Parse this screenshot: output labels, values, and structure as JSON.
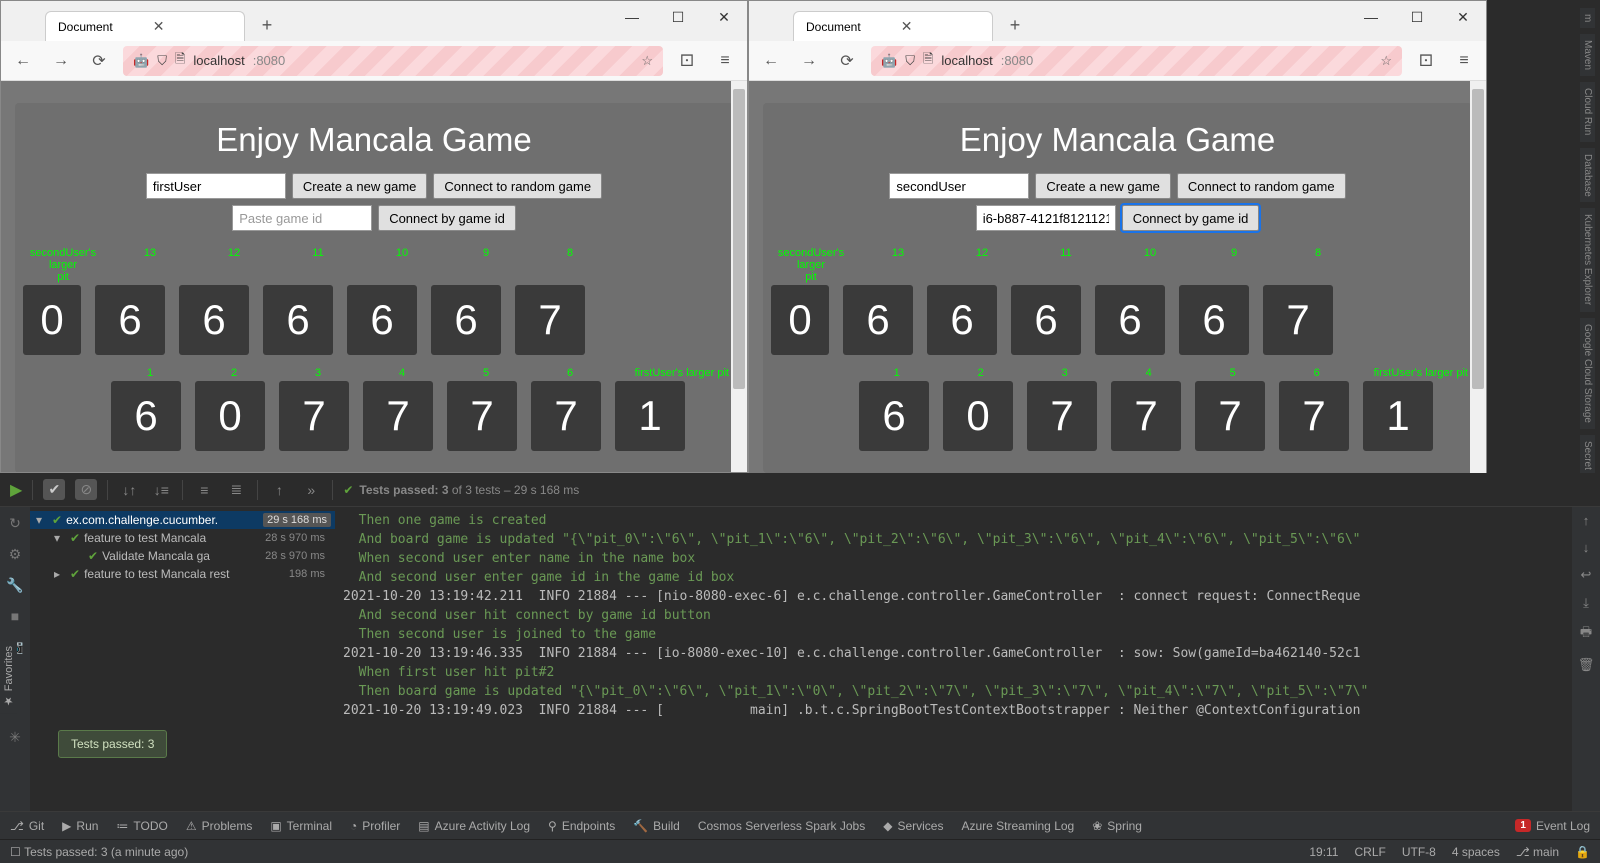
{
  "browser1": {
    "tab_title": "Document",
    "url_host": "localhost",
    "url_port": ":8080",
    "game": {
      "title": "Enjoy Mancala Game",
      "username": "firstUser",
      "create_btn": "Create a new game",
      "connect_random_btn": "Connect to random game",
      "gameid_placeholder": "Paste game id",
      "gameid_value": "",
      "connect_by_id_btn": "Connect by game id",
      "top_larger_label_prefix": "secondUser's larger",
      "top_larger_label_suffix": "pit",
      "top_indices": [
        "13",
        "12",
        "11",
        "10",
        "9",
        "8"
      ],
      "top_big": "0",
      "top_pits": [
        "6",
        "6",
        "6",
        "6",
        "6",
        "7"
      ],
      "bottom_indices": [
        "1",
        "2",
        "3",
        "4",
        "5",
        "6"
      ],
      "bottom_larger_label": "firstUser's larger pit",
      "bottom_pits": [
        "6",
        "0",
        "7",
        "7",
        "7",
        "7",
        "1"
      ]
    }
  },
  "browser2": {
    "tab_title": "Document",
    "url_host": "localhost",
    "url_port": ":8080",
    "game": {
      "title": "Enjoy Mancala Game",
      "username": "secondUser",
      "create_btn": "Create a new game",
      "connect_random_btn": "Connect to random game",
      "gameid_value": "i6-b887-4121f8121121",
      "connect_by_id_btn": "Connect by game id",
      "top_larger_label_prefix": "secondUser's larger",
      "top_larger_label_suffix": "pit",
      "top_indices": [
        "13",
        "12",
        "11",
        "10",
        "9",
        "8"
      ],
      "top_big": "0",
      "top_pits": [
        "6",
        "6",
        "6",
        "6",
        "6",
        "7"
      ],
      "bottom_indices": [
        "1",
        "2",
        "3",
        "4",
        "5",
        "6"
      ],
      "bottom_larger_label": "firstUser's larger pit",
      "bottom_pits": [
        "6",
        "0",
        "7",
        "7",
        "7",
        "7",
        "1"
      ]
    }
  },
  "ide": {
    "tests_summary_prefix": "Tests passed: 3",
    "tests_summary_suffix": " of 3 tests – 29 s 168 ms",
    "tree": [
      {
        "name": "ex.com.challenge.cucumber.",
        "time": "29 s 168 ms",
        "indent": 0,
        "chev": "▾",
        "sel": true
      },
      {
        "name": "feature to test Mancala",
        "time": "28 s 970 ms",
        "indent": 1,
        "chev": "▾"
      },
      {
        "name": "Validate Mancala ga",
        "time": "28 s 970 ms",
        "indent": 2,
        "chev": ""
      },
      {
        "name": "feature to test Mancala rest",
        "time": "198 ms",
        "indent": 1,
        "chev": "▸"
      }
    ],
    "console_lines": [
      {
        "cls": "cg",
        "text": "  Then one game is created"
      },
      {
        "cls": "cg",
        "text": "  And board game is updated \"{\\\"pit_0\\\":\\\"6\\\", \\\"pit_1\\\":\\\"6\\\", \\\"pit_2\\\":\\\"6\\\", \\\"pit_3\\\":\\\"6\\\", \\\"pit_4\\\":\\\"6\\\", \\\"pit_5\\\":\\\"6\\\""
      },
      {
        "cls": "cg",
        "text": "  When second user enter name in the name box"
      },
      {
        "cls": "cg",
        "text": "  And second user enter game id in the game id box"
      },
      {
        "cls": "cw",
        "text": "2021-10-20 13:19:42.211  INFO 21884 --- [nio-8080-exec-6] e.c.challenge.controller.GameController  : connect request: ConnectReque"
      },
      {
        "cls": "cg",
        "text": "  And second user hit connect by game id button"
      },
      {
        "cls": "cg",
        "text": "  Then second user is joined to the game"
      },
      {
        "cls": "cw",
        "text": "2021-10-20 13:19:46.335  INFO 21884 --- [io-8080-exec-10] e.c.challenge.controller.GameController  : sow: Sow(gameId=ba462140-52c1"
      },
      {
        "cls": "cg",
        "text": "  When first user hit pit#2"
      },
      {
        "cls": "cg",
        "text": "  Then board game is updated \"{\\\"pit_0\\\":\\\"6\\\", \\\"pit_1\\\":\\\"0\\\", \\\"pit_2\\\":\\\"7\\\", \\\"pit_3\\\":\\\"7\\\", \\\"pit_4\\\":\\\"7\\\", \\\"pit_5\\\":\\\"7\\\""
      },
      {
        "cls": "cw",
        "text": "2021-10-20 13:19:49.023  INFO 21884 --- [           main] .b.t.c.SpringBootTestContextBootstrapper : Neither @ContextConfiguration"
      }
    ],
    "bottom": {
      "git": "Git",
      "run": "Run",
      "todo": "TODO",
      "problems": "Problems",
      "terminal": "Terminal",
      "profiler": "Profiler",
      "azure": "Azure Activity Log",
      "endpoints": "Endpoints",
      "build": "Build",
      "cosmos": "Cosmos Serverless Spark Jobs",
      "services": "Services",
      "stream": "Azure Streaming Log",
      "spring": "Spring",
      "eventlog": "Event Log",
      "eventcount": "1"
    },
    "status": {
      "left": "Tests passed: 3 (a minute ago)",
      "time": "19:11",
      "le": "CRLF",
      "enc": "UTF-8",
      "indent": "4 spaces",
      "branch": "main"
    },
    "tooltip": "Tests passed: 3",
    "right_tabs": [
      "m",
      "Maven",
      "Cloud Run",
      "Database",
      "Kubernetes Explorer",
      "Google Cloud Storage",
      "Secret Ma"
    ]
  }
}
